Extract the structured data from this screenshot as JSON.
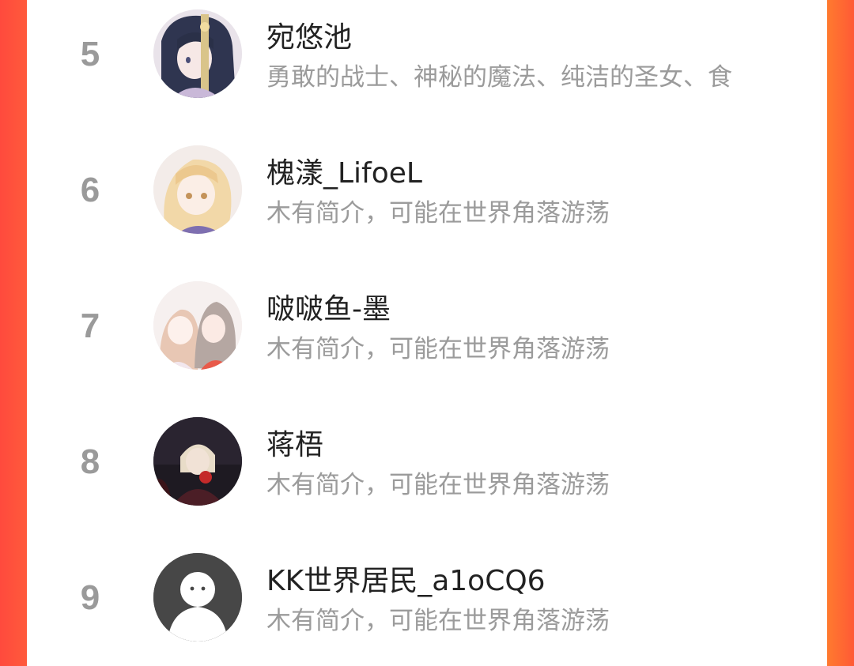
{
  "colors": {
    "accent_left": "#ff4a3d",
    "accent_right": "#ff7a2f",
    "rank_color": "#9a9a9a",
    "name_color": "#222222",
    "bio_color": "#9b9b9b"
  },
  "list": {
    "items": [
      {
        "rank": "5",
        "name": "宛悠池",
        "bio": "勇敢的战士、神秘的魔法、纯洁的圣女、食",
        "avatar_icon": "anime-avatar-dark-hair"
      },
      {
        "rank": "6",
        "name": "槐漾_LifoeL",
        "bio": "木有简介，可能在世界角落游荡",
        "avatar_icon": "anime-avatar-blonde"
      },
      {
        "rank": "7",
        "name": "啵啵鱼-墨",
        "bio": "木有简介，可能在世界角落游荡",
        "avatar_icon": "anime-avatar-pair"
      },
      {
        "rank": "8",
        "name": "蒋梧",
        "bio": "木有简介，可能在世界角落游荡",
        "avatar_icon": "anime-avatar-dark-scene"
      },
      {
        "rank": "9",
        "name": "KK世界居民_a1oCQ6",
        "bio": "木有简介，可能在世界角落游荡",
        "avatar_icon": "default-user-avatar"
      }
    ]
  }
}
